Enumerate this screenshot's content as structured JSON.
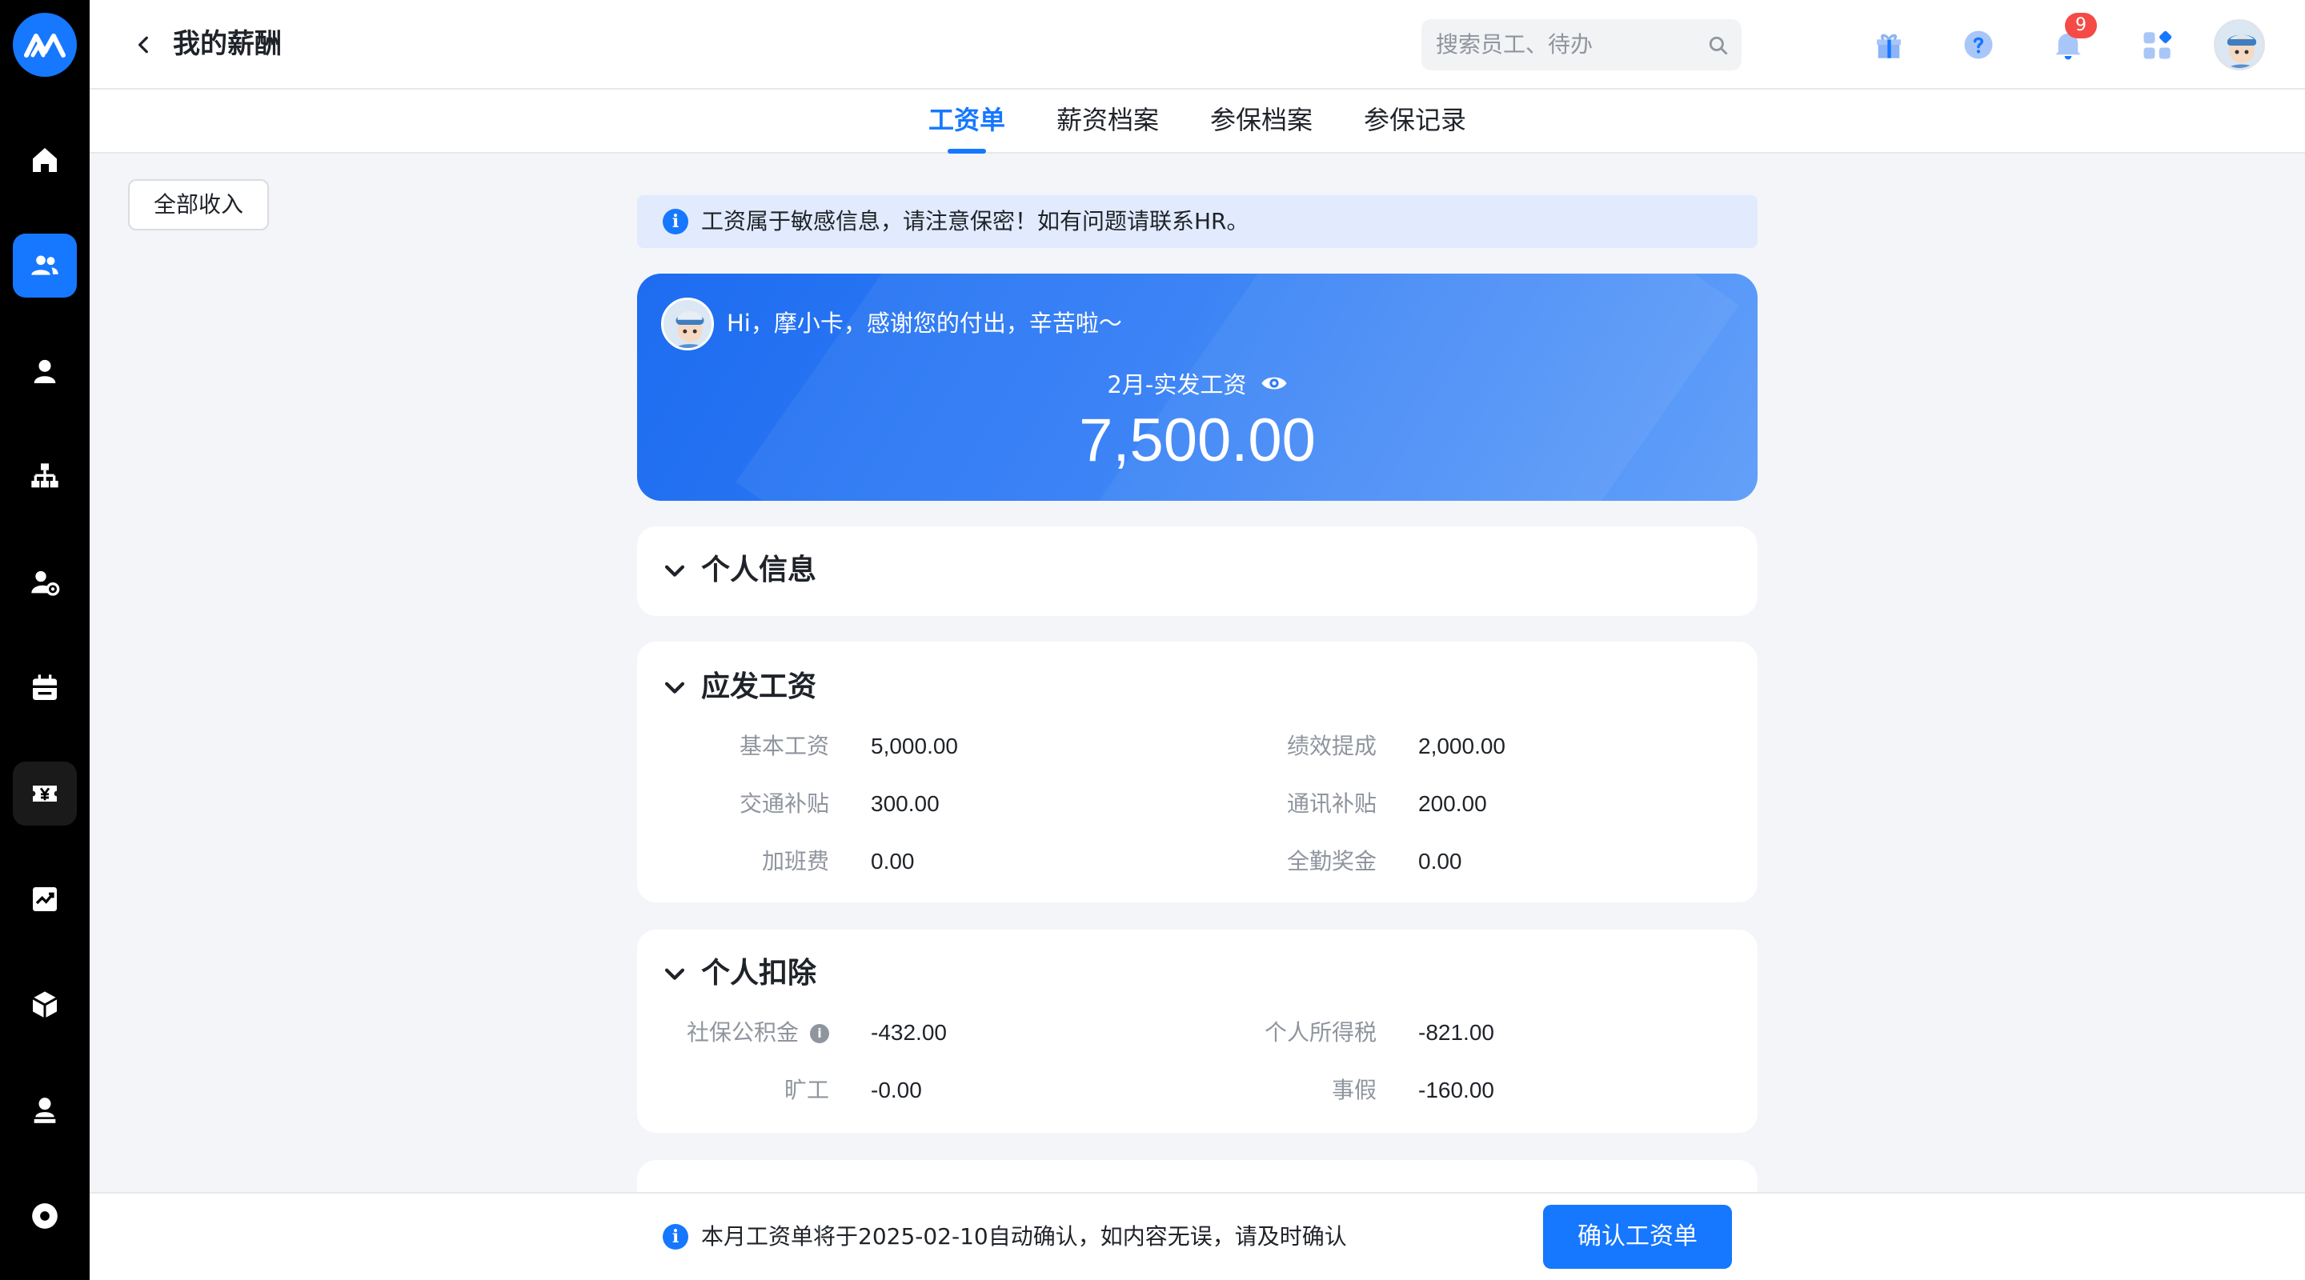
{
  "header": {
    "title": "我的薪酬",
    "search_placeholder": "搜索员工、待办",
    "notification_count": "9"
  },
  "tabs": [
    {
      "label": "工资单",
      "active": true
    },
    {
      "label": "薪资档案",
      "active": false
    },
    {
      "label": "参保档案",
      "active": false
    },
    {
      "label": "参保记录",
      "active": false
    }
  ],
  "filter": {
    "label": "全部收入"
  },
  "notice": {
    "text": "工资属于敏感信息，请注意保密！如有问题请联系HR。"
  },
  "salary_card": {
    "greeting": "Hi，摩小卡，感谢您的付出，辛苦啦～",
    "label": "2月-实发工资",
    "amount": "7,500.00"
  },
  "sections": {
    "personal_info": {
      "title": "个人信息"
    },
    "gross_pay": {
      "title": "应发工资",
      "items": [
        {
          "label": "基本工资",
          "value": "5,000.00"
        },
        {
          "label": "绩效提成",
          "value": "2,000.00"
        },
        {
          "label": "交通补贴",
          "value": "300.00"
        },
        {
          "label": "通讯补贴",
          "value": "200.00"
        },
        {
          "label": "加班费",
          "value": "0.00"
        },
        {
          "label": "全勤奖金",
          "value": "0.00"
        }
      ]
    },
    "deductions": {
      "title": "个人扣除",
      "items": [
        {
          "label": "社保公积金",
          "value": "-432.00"
        },
        {
          "label": "个人所得税",
          "value": "-821.00"
        },
        {
          "label": "旷工",
          "value": "-0.00"
        },
        {
          "label": "事假",
          "value": "-160.00"
        }
      ]
    }
  },
  "bottom_bar": {
    "notice": "本月工资单将于2025-02-10自动确认，如内容无误，请及时确认",
    "confirm_label": "确认工资单"
  },
  "sidebar": {
    "icons": [
      "logo-icon",
      "home-icon",
      "team-icon",
      "user-icon",
      "org-chart-icon",
      "user-settings-icon",
      "calendar-icon",
      "salary-icon",
      "report-icon",
      "package-icon",
      "profile-icon",
      "settings-icon"
    ]
  },
  "colors": {
    "accent": "#1677ff",
    "rail": "#000000",
    "page_bg": "#f3f5f9",
    "badge": "#f54a45"
  }
}
